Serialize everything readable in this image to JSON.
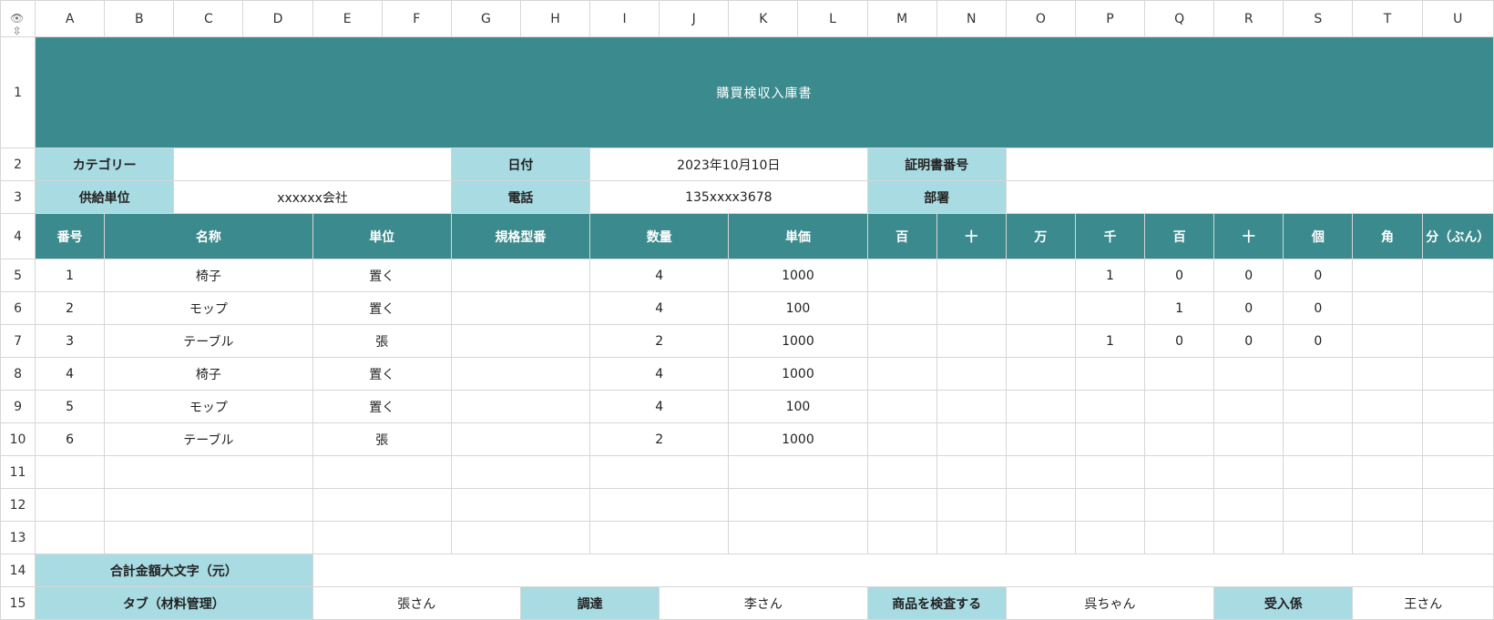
{
  "columns": [
    "A",
    "B",
    "C",
    "D",
    "E",
    "F",
    "G",
    "H",
    "I",
    "J",
    "K",
    "L",
    "M",
    "N",
    "O",
    "P",
    "Q",
    "R",
    "S",
    "T",
    "U"
  ],
  "row_numbers": [
    "1",
    "2",
    "3",
    "4",
    "5",
    "6",
    "7",
    "8",
    "9",
    "10",
    "11",
    "12",
    "13",
    "14",
    "15"
  ],
  "title": "購買検収入庫書",
  "info": {
    "category_label": "カテゴリー",
    "category_value": "",
    "date_label": "日付",
    "date_value": "2023年10月10日",
    "cert_label": "証明書番号",
    "cert_value": "",
    "supplier_label": "供給単位",
    "supplier_value": "xxxxxx会社",
    "phone_label": "電話",
    "phone_value": "135xxxx3678",
    "dept_label": "部署",
    "dept_value": ""
  },
  "headers": [
    "番号",
    "名称",
    "単位",
    "規格型番",
    "数量",
    "単価",
    "百",
    "十",
    "万",
    "千",
    "百",
    "十",
    "個",
    "角",
    "分（ぶん）"
  ],
  "rows": [
    {
      "no": "1",
      "name": "椅子",
      "unit": "置く",
      "spec": "",
      "qty": "4",
      "price": "1000",
      "d": [
        "",
        "",
        "",
        "1",
        "0",
        "0",
        "0",
        "",
        ""
      ]
    },
    {
      "no": "2",
      "name": "モップ",
      "unit": "置く",
      "spec": "",
      "qty": "4",
      "price": "100",
      "d": [
        "",
        "",
        "",
        "",
        "1",
        "0",
        "0",
        "",
        ""
      ]
    },
    {
      "no": "3",
      "name": "テーブル",
      "unit": "張",
      "spec": "",
      "qty": "2",
      "price": "1000",
      "d": [
        "",
        "",
        "",
        "1",
        "0",
        "0",
        "0",
        "",
        ""
      ]
    },
    {
      "no": "4",
      "name": "椅子",
      "unit": "置く",
      "spec": "",
      "qty": "4",
      "price": "1000",
      "d": [
        "",
        "",
        "",
        "",
        "",
        "",
        "",
        "",
        ""
      ]
    },
    {
      "no": "5",
      "name": "モップ",
      "unit": "置く",
      "spec": "",
      "qty": "4",
      "price": "100",
      "d": [
        "",
        "",
        "",
        "",
        "",
        "",
        "",
        "",
        ""
      ]
    },
    {
      "no": "6",
      "name": "テーブル",
      "unit": "張",
      "spec": "",
      "qty": "2",
      "price": "1000",
      "d": [
        "",
        "",
        "",
        "",
        "",
        "",
        "",
        "",
        ""
      ]
    },
    {
      "no": "",
      "name": "",
      "unit": "",
      "spec": "",
      "qty": "",
      "price": "",
      "d": [
        "",
        "",
        "",
        "",
        "",
        "",
        "",
        "",
        ""
      ]
    },
    {
      "no": "",
      "name": "",
      "unit": "",
      "spec": "",
      "qty": "",
      "price": "",
      "d": [
        "",
        "",
        "",
        "",
        "",
        "",
        "",
        "",
        ""
      ]
    },
    {
      "no": "",
      "name": "",
      "unit": "",
      "spec": "",
      "qty": "",
      "price": "",
      "d": [
        "",
        "",
        "",
        "",
        "",
        "",
        "",
        "",
        ""
      ]
    }
  ],
  "total": {
    "label": "合計金額大文字（元）",
    "value": ""
  },
  "footer": {
    "tab_label": "タブ（材料管理）",
    "tab_value": "張さん",
    "procure_label": "調達",
    "procure_value": "李さん",
    "inspect_label": "商品を検査する",
    "inspect_value": "呉ちゃん",
    "receiver_label": "受入係",
    "receiver_value": "王さん"
  },
  "colors": {
    "teal": "#3b8a8d",
    "light_blue": "#a9dbe3",
    "grid": "#d6d6d6"
  },
  "icons": [
    "eye-icon",
    "collapse-columns-icon",
    "collapse-rows-icon"
  ]
}
